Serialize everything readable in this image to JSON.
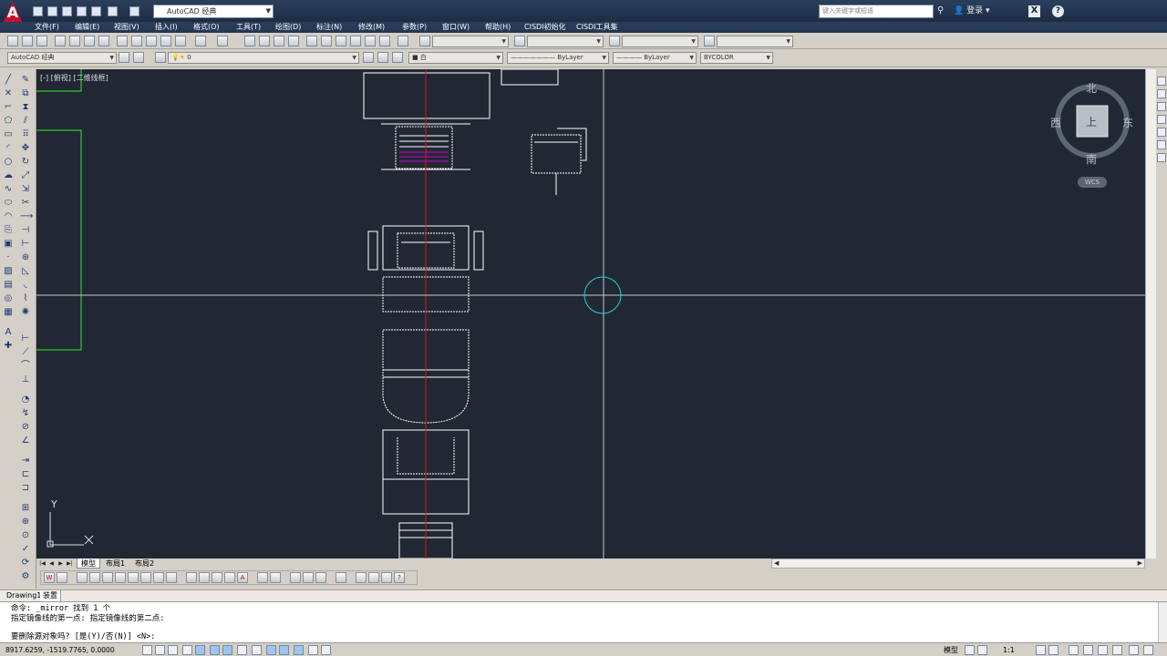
{
  "title_bar": {
    "logo": "A",
    "workspace": "AutoCAD 经典",
    "search_placeholder": "键入关键字或短语",
    "login_label": "登录"
  },
  "menu": [
    {
      "label": "文件(F)"
    },
    {
      "label": "编辑(E)"
    },
    {
      "label": "视图(V)"
    },
    {
      "label": "插入(I)"
    },
    {
      "label": "格式(O)"
    },
    {
      "label": "工具(T)"
    },
    {
      "label": "绘图(D)"
    },
    {
      "label": "标注(N)"
    },
    {
      "label": "修改(M)"
    },
    {
      "label": "参数(P)"
    },
    {
      "label": "窗口(W)"
    },
    {
      "label": "帮助(H)"
    },
    {
      "label": "CISDI初始化"
    },
    {
      "label": "CISDI工具集"
    }
  ],
  "toolbar2": {
    "workspace_combo": "AutoCAD 经典",
    "layer_combo": "0",
    "color_combo": "白",
    "linetype_combo": "ByLayer",
    "lineweight_combo": "ByLayer",
    "plotstyle_combo": "BYCOLOR"
  },
  "viewport": {
    "view_label": "[-] [俯视] [二维线框]",
    "compass_north": "北",
    "compass_south": "南",
    "compass_east": "东",
    "compass_west": "西",
    "compass_center": "上",
    "wcs": "WCS",
    "axis_y": "Y"
  },
  "layout_tabs": [
    {
      "label": "模型",
      "active": true
    },
    {
      "label": "布局1",
      "active": false
    },
    {
      "label": "布局2",
      "active": false
    }
  ],
  "drawing_tabs": [
    {
      "label": "Drawing1",
      "active": false
    },
    {
      "label": "装置",
      "active": true
    }
  ],
  "command_lines": [
    "命令: _mirror 找到 1 个",
    "指定镜像线的第一点: 指定镜像线的第二点:",
    "要删除源对象吗? [是(Y)/否(N)] <N>:"
  ],
  "status_bar": {
    "coords": "8917.6259, -1519.7765, 0.0000",
    "model_label": "模型",
    "scale_label": "1:1"
  },
  "colors": {
    "canvas_bg": "#212834",
    "drawing_lines": "#ffffff",
    "centerline": "#e01010",
    "highlight": "#d000d0",
    "green_frame": "#2ee82e",
    "cursor_circle": "#20d0d0"
  }
}
